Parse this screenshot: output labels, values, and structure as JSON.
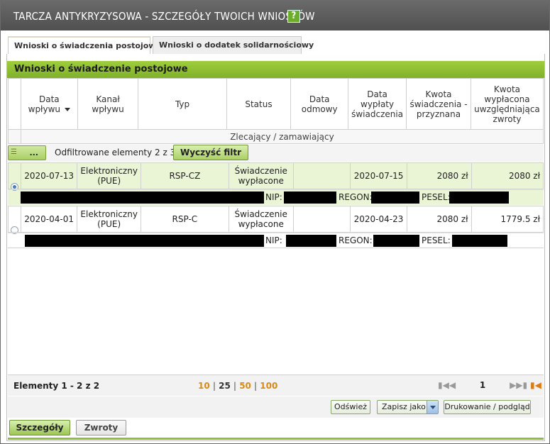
{
  "window": {
    "title": "TARCZA ANTYKRYZYSOWA - SZCZEGÓŁY TWOICH WNIOSKÓW",
    "help_label": "?"
  },
  "tabs": [
    {
      "label": "Wnioski o świadczenia postojowe",
      "active": true
    },
    {
      "label": "Wnioski o dodatek solidarnościowy",
      "active": false
    }
  ],
  "panel": {
    "title": "Wnioski o świadczenie postojowe"
  },
  "table": {
    "columns": [
      {
        "label": "Data wpływu",
        "sorted": true
      },
      {
        "label": "Kanał wpływu"
      },
      {
        "label": "Typ"
      },
      {
        "label": "Status"
      },
      {
        "label": "Data odmowy"
      },
      {
        "label": "Data wypłaty świadczenia"
      },
      {
        "label": "Kwota świadczenia - przyznana"
      },
      {
        "label": "Kwota wypłacona uwzględniająca zwroty"
      }
    ],
    "subheader": "Zlecający / zamawiający",
    "rows": [
      {
        "selected": true,
        "data_wplywu": "2020-07-13",
        "kanal": "Elektroniczny (PUE)",
        "typ": "RSP-CZ",
        "status": "Świadczenie wypłacone",
        "data_odmowy": "",
        "data_wyplaty": "2020-07-15",
        "kwota_przyznana": "2080 zł",
        "kwota_wyplacona": "2080 zł",
        "nip_label": "NIP:",
        "regon_label": "REGON:",
        "pesel_label": "PESEL:"
      },
      {
        "selected": false,
        "data_wplywu": "2020-04-01",
        "kanal": "Elektroniczny (PUE)",
        "typ": "RSP-C",
        "status": "Świadczenie wypłacone",
        "data_odmowy": "",
        "data_wyplaty": "2020-04-23",
        "kwota_przyznana": "2080 zł",
        "kwota_wyplacona": "1779.5 zł",
        "nip_label": "NIP:",
        "regon_label": "REGON:",
        "pesel_label": "PESEL:"
      }
    ]
  },
  "filter": {
    "options_label": "...",
    "filtered_text": "Odfiltrowane elementy 2 z 3.",
    "clear_label": "Wyczyść filtr"
  },
  "footer": {
    "elements_text": "Elementy 1 - 2 z 2",
    "page_sizes": [
      "10",
      "25",
      "50",
      "100"
    ],
    "active_page_size": "25",
    "current_page": "1"
  },
  "actions": {
    "refresh_label": "Odśwież",
    "save_as_label": "Zapisz jako",
    "print_label": "Drukowanie / podgląd"
  },
  "bottom": {
    "details_label": "Szczegóły",
    "returns_label": "Zwroty"
  }
}
